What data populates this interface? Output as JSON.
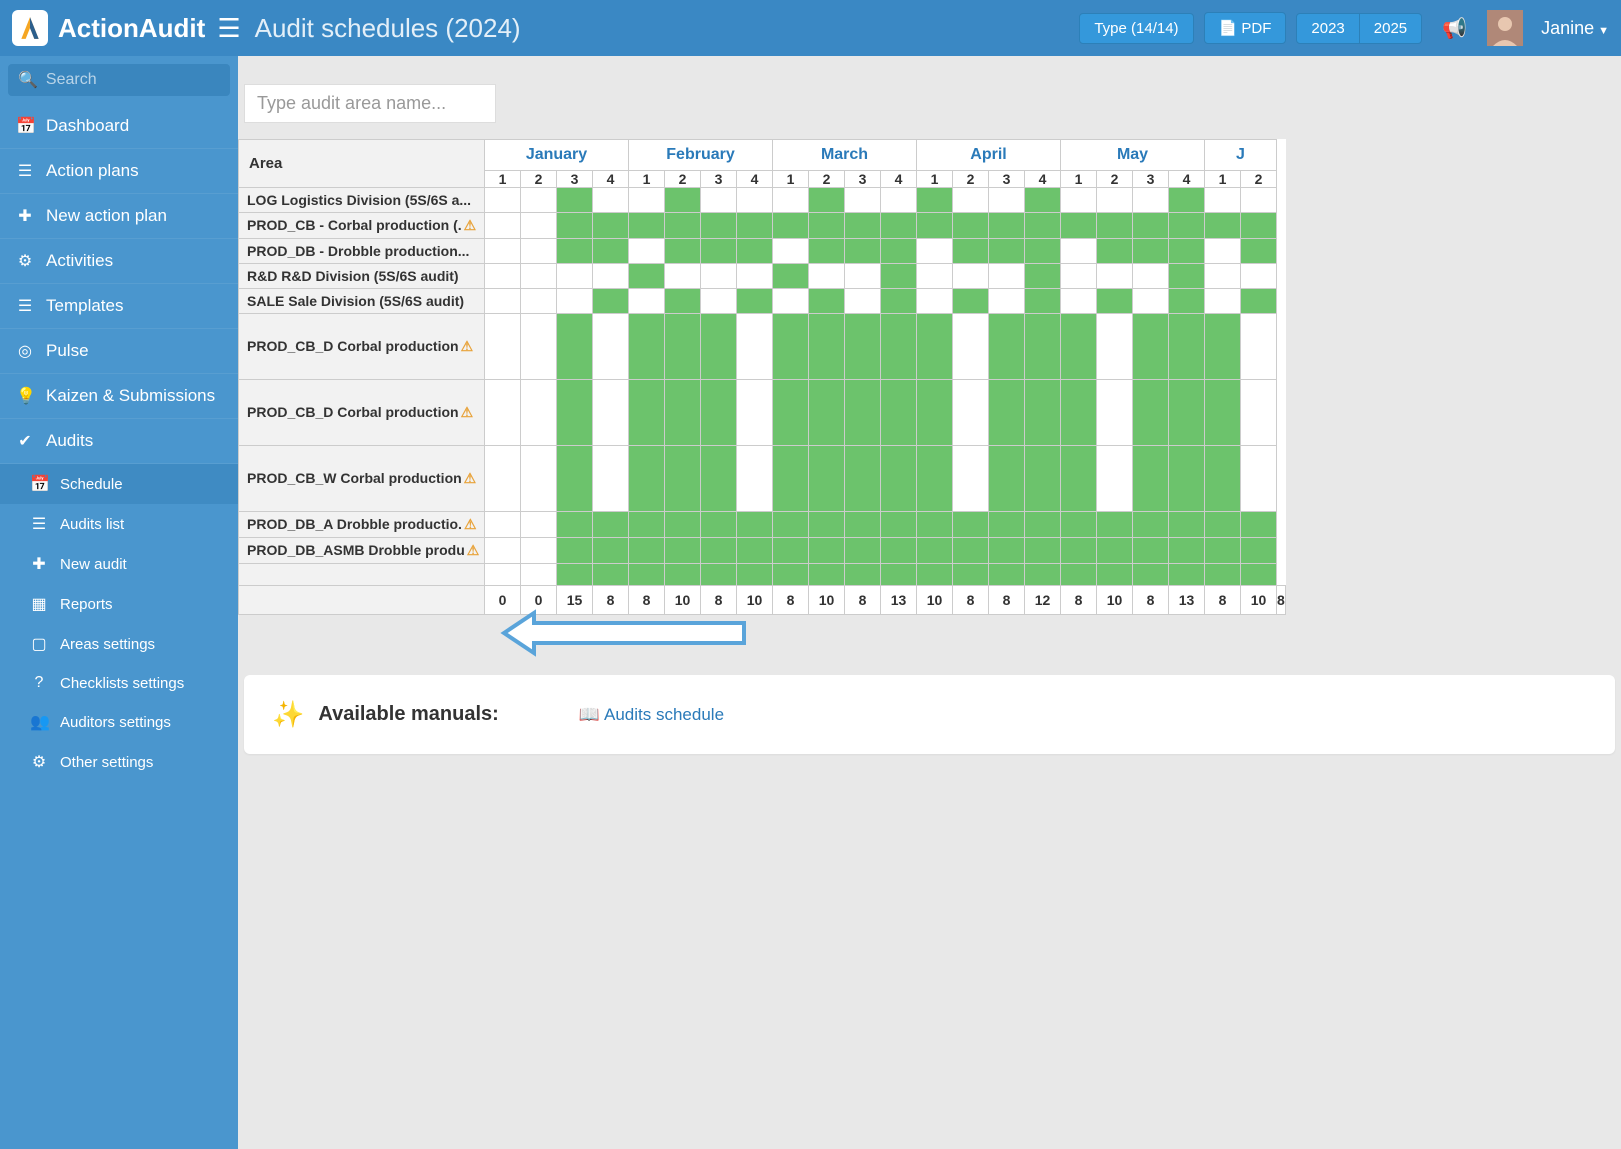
{
  "brand": "ActionAudit",
  "page_title": "Audit schedules (2024)",
  "top": {
    "type_btn": "Type (14/14)",
    "pdf_btn": "PDF",
    "year_prev": "2023",
    "year_next": "2025",
    "username": "Janine"
  },
  "search": {
    "placeholder": "Search"
  },
  "nav": {
    "dashboard": "Dashboard",
    "action_plans": "Action plans",
    "new_action_plan": "New action plan",
    "activities": "Activities",
    "templates": "Templates",
    "pulse": "Pulse",
    "kaizen": "Kaizen & Submissions",
    "audits": "Audits",
    "schedule": "Schedule",
    "audits_list": "Audits list",
    "new_audit": "New audit",
    "reports": "Reports",
    "areas_settings": "Areas settings",
    "checklists_settings": "Checklists settings",
    "auditors_settings": "Auditors settings",
    "other_settings": "Other settings"
  },
  "area_input_placeholder": "Type audit area name...",
  "table": {
    "area_header": "Area",
    "months": [
      "January",
      "February",
      "March",
      "April",
      "May"
    ],
    "weeks": [
      "1",
      "2",
      "3",
      "4",
      "1",
      "2",
      "3",
      "4",
      "1",
      "2",
      "3",
      "4",
      "1",
      "2",
      "3",
      "4",
      "1",
      "2",
      "3",
      "4",
      "1",
      "2"
    ],
    "rows": [
      {
        "label": "LOG Logistics Division (5S/6S a...",
        "warn": false,
        "tall": false,
        "cells": [
          0,
          0,
          1,
          0,
          0,
          1,
          0,
          0,
          0,
          1,
          0,
          0,
          1,
          0,
          0,
          1,
          0,
          0,
          0,
          1,
          0,
          0,
          1,
          0
        ]
      },
      {
        "label": "PROD_CB - Corbal production (.",
        "warn": true,
        "tall": false,
        "cells": [
          0,
          0,
          1,
          1,
          1,
          1,
          1,
          1,
          1,
          1,
          1,
          1,
          1,
          1,
          1,
          1,
          1,
          1,
          1,
          1,
          1,
          1,
          1,
          1
        ]
      },
      {
        "label": "PROD_DB - Drobble production...",
        "warn": false,
        "tall": false,
        "cells": [
          0,
          0,
          1,
          1,
          0,
          1,
          1,
          1,
          0,
          1,
          1,
          1,
          0,
          1,
          1,
          1,
          0,
          1,
          1,
          1,
          0,
          1,
          1,
          1
        ]
      },
      {
        "label": "R&D R&D Division (5S/6S audit)",
        "warn": false,
        "tall": false,
        "cells": [
          0,
          0,
          0,
          0,
          1,
          0,
          0,
          0,
          1,
          0,
          0,
          1,
          0,
          0,
          0,
          1,
          0,
          0,
          0,
          1,
          0,
          0,
          0,
          1
        ]
      },
      {
        "label": "SALE Sale Division (5S/6S audit)",
        "warn": false,
        "tall": false,
        "cells": [
          0,
          0,
          0,
          1,
          0,
          1,
          0,
          1,
          0,
          1,
          0,
          1,
          0,
          1,
          0,
          1,
          0,
          1,
          0,
          1,
          0,
          1,
          0,
          1
        ]
      },
      {
        "label": "PROD_CB_D Corbal production",
        "warn": true,
        "tall": true,
        "cells": [
          0,
          0,
          1,
          0,
          1,
          1,
          1,
          0,
          1,
          1,
          1,
          1,
          1,
          0,
          1,
          1,
          1,
          0,
          1,
          1,
          1,
          0,
          1,
          1
        ]
      },
      {
        "label": "PROD_CB_D Corbal production",
        "warn": true,
        "tall": true,
        "cells": [
          0,
          0,
          1,
          0,
          1,
          1,
          1,
          0,
          1,
          1,
          1,
          1,
          1,
          0,
          1,
          1,
          1,
          0,
          1,
          1,
          1,
          0,
          1,
          1
        ]
      },
      {
        "label": "PROD_CB_W Corbal production",
        "warn": true,
        "tall": true,
        "cells": [
          0,
          0,
          1,
          0,
          1,
          1,
          1,
          0,
          1,
          1,
          1,
          1,
          1,
          0,
          1,
          1,
          1,
          0,
          1,
          1,
          1,
          0,
          1,
          1
        ]
      },
      {
        "label": "PROD_DB_A Drobble productio.",
        "warn": true,
        "tall": false,
        "cells": [
          0,
          0,
          1,
          1,
          1,
          1,
          1,
          1,
          1,
          1,
          1,
          1,
          1,
          1,
          1,
          1,
          1,
          1,
          1,
          1,
          1,
          1,
          1,
          1
        ]
      },
      {
        "label": "PROD_DB_ASMB Drobble produ",
        "warn": true,
        "tall": false,
        "cells": [
          0,
          0,
          1,
          1,
          1,
          1,
          1,
          1,
          1,
          1,
          1,
          1,
          1,
          1,
          1,
          1,
          1,
          1,
          1,
          1,
          1,
          1,
          1,
          1
        ]
      },
      {
        "label": "",
        "warn": false,
        "tall": false,
        "cells": [
          0,
          0,
          1,
          1,
          1,
          1,
          1,
          1,
          1,
          1,
          1,
          1,
          1,
          1,
          1,
          1,
          1,
          1,
          1,
          1,
          1,
          1,
          1,
          1
        ]
      }
    ],
    "totals": [
      "0",
      "0",
      "15",
      "8",
      "8",
      "10",
      "8",
      "10",
      "8",
      "10",
      "8",
      "13",
      "10",
      "8",
      "8",
      "12",
      "8",
      "10",
      "8",
      "13",
      "8",
      "10",
      "8"
    ]
  },
  "manuals": {
    "title": "Available manuals:",
    "link": "Audits schedule"
  }
}
